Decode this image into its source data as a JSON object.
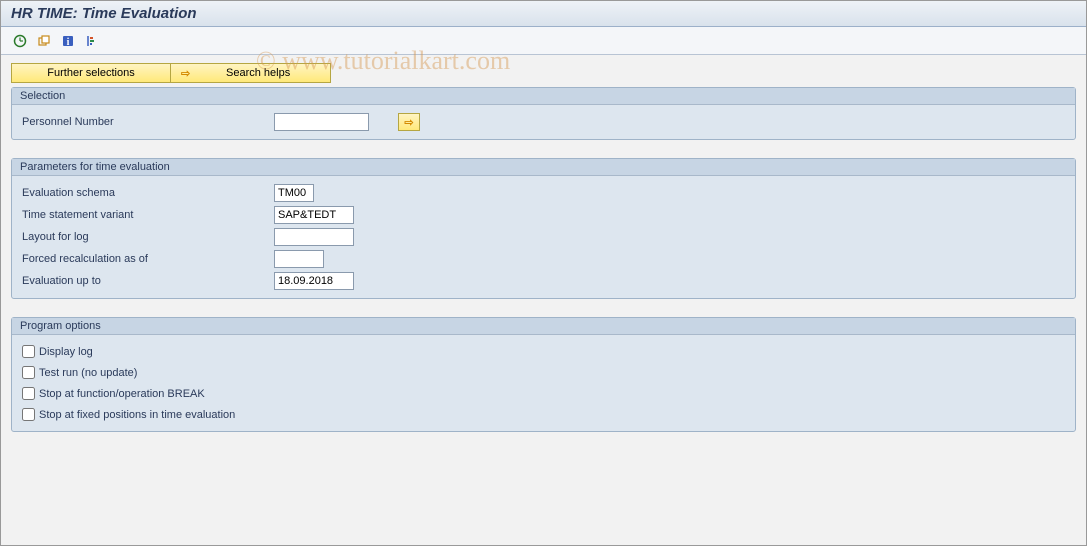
{
  "title": "HR TIME: Time Evaluation",
  "watermark": "© www.tutorialkart.com",
  "toolbar": {
    "execute": "⊕",
    "variants": "⎘",
    "info": "ℹ",
    "structure": "⦀"
  },
  "buttons": {
    "further_selections": "Further selections",
    "search_helps": "Search helps"
  },
  "panels": {
    "selection": {
      "title": "Selection",
      "personnel_number_label": "Personnel Number",
      "personnel_number_value": ""
    },
    "params": {
      "title": "Parameters for time evaluation",
      "eval_schema_label": "Evaluation schema",
      "eval_schema_value": "TM00",
      "time_stmt_label": "Time statement variant",
      "time_stmt_value": "SAP&TEDT",
      "layout_label": "Layout for log",
      "layout_value": "",
      "forced_recalc_label": "Forced recalculation as of",
      "forced_recalc_value": "",
      "eval_upto_label": "Evaluation up to",
      "eval_upto_value": "18.09.2018"
    },
    "options": {
      "title": "Program options",
      "display_log_label": "Display log",
      "test_run_label": "Test run (no update)",
      "stop_break_label": "Stop at function/operation BREAK",
      "stop_fixed_label": "Stop at fixed positions in time evaluation"
    }
  }
}
